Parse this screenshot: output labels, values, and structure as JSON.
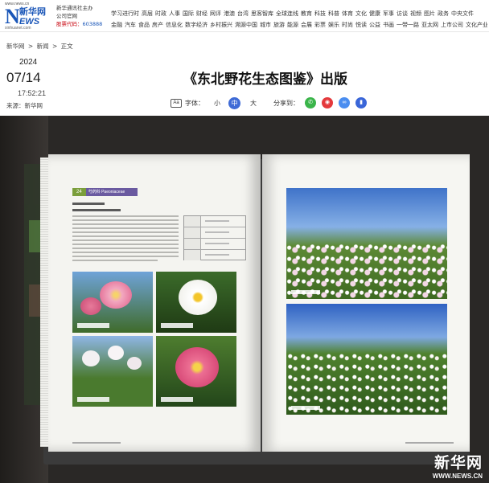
{
  "logo": {
    "url_top": "www.news.cn",
    "letter": "N",
    "cn": "新华网",
    "en": "EWS",
    "url_bottom": "xinhuanet.com"
  },
  "sponsor": {
    "line1": "新华通讯社主办",
    "line2": "公司官网",
    "code_label": "股票代码：",
    "code_value": "603888"
  },
  "nav": {
    "row1": [
      "学习进行时",
      "高层",
      "时政",
      "人事",
      "国际",
      "财经",
      "网评",
      "港澳",
      "台湾",
      "思客智库",
      "全球连线",
      "教育",
      "科技",
      "科普",
      "体育",
      "文化",
      "健康",
      "军事",
      "访谈",
      "视频",
      "图片",
      "政务",
      "中央文件"
    ],
    "row2": [
      "金融",
      "汽车",
      "食品",
      "房产",
      "信息化",
      "数字经济",
      "乡村振兴",
      "溯源中国",
      "城市",
      "旅游",
      "能源",
      "会展",
      "彩票",
      "娱乐",
      "时尚",
      "悦读",
      "公益",
      "书画",
      "一带一路",
      "亚太网",
      "上市公司",
      "文化产业"
    ]
  },
  "breadcrumb": [
    "新华网",
    ">",
    "新闻",
    ">",
    "正文"
  ],
  "date": {
    "year": "2024",
    "month_day": "07/14",
    "time": "17:52:21",
    "source": "来源：新华网"
  },
  "article": {
    "title": "《东北野花生态图鉴》出版"
  },
  "font_control": {
    "label": "字体：",
    "small": "小",
    "medium": "中",
    "large": "大"
  },
  "share": {
    "label": "分享到："
  },
  "watermark": {
    "cn": "新华网",
    "url": "WWW.NEWS.CN"
  },
  "colors": {
    "brand_blue": "#1a56b8",
    "stock_red": "#c7000b",
    "active_font": "#3f6bd6"
  },
  "icons": {
    "font": "aa-icon",
    "wechat": "wechat-icon",
    "weibo": "weibo-icon",
    "link": "link-icon",
    "app": "app-icon"
  }
}
